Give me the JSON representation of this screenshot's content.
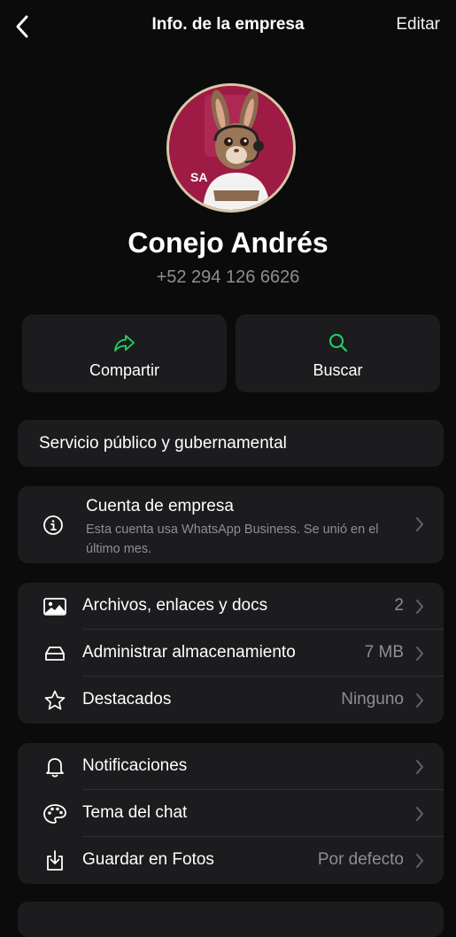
{
  "nav": {
    "title": "Info. de la empresa",
    "edit_label": "Editar",
    "back_icon": "chevron-left-icon"
  },
  "profile": {
    "name": "Conejo Andrés",
    "phone": "+52 294 126 6626",
    "avatar_text": "SA",
    "avatar_bg": "#9d1b45"
  },
  "actions": {
    "share_label": "Compartir",
    "share_icon": "share-arrow-icon",
    "search_label": "Buscar",
    "search_icon": "search-icon",
    "accent": "#25d366"
  },
  "category": {
    "text": "Servicio público y gubernamental"
  },
  "business": {
    "title": "Cuenta de empresa",
    "description": "Esta cuenta usa WhatsApp Business. Se unió en el último mes.",
    "icon": "info-circle-icon"
  },
  "media": {
    "items": [
      {
        "label": "Archivos, enlaces y docs",
        "value": "2",
        "icon": "image-icon"
      },
      {
        "label": "Administrar almacenamiento",
        "value": "7 MB",
        "icon": "storage-icon"
      },
      {
        "label": "Destacados",
        "value": "Ninguno",
        "icon": "star-icon"
      }
    ]
  },
  "settings": {
    "items": [
      {
        "label": "Notificaciones",
        "value": "",
        "icon": "bell-icon"
      },
      {
        "label": "Tema del chat",
        "value": "",
        "icon": "palette-icon"
      },
      {
        "label": "Guardar en Fotos",
        "value": "Por defecto",
        "icon": "save-download-icon"
      }
    ]
  },
  "colors": {
    "background": "#0b0b0b",
    "card": "#1c1c1e",
    "secondary_text": "#8e8e93"
  }
}
